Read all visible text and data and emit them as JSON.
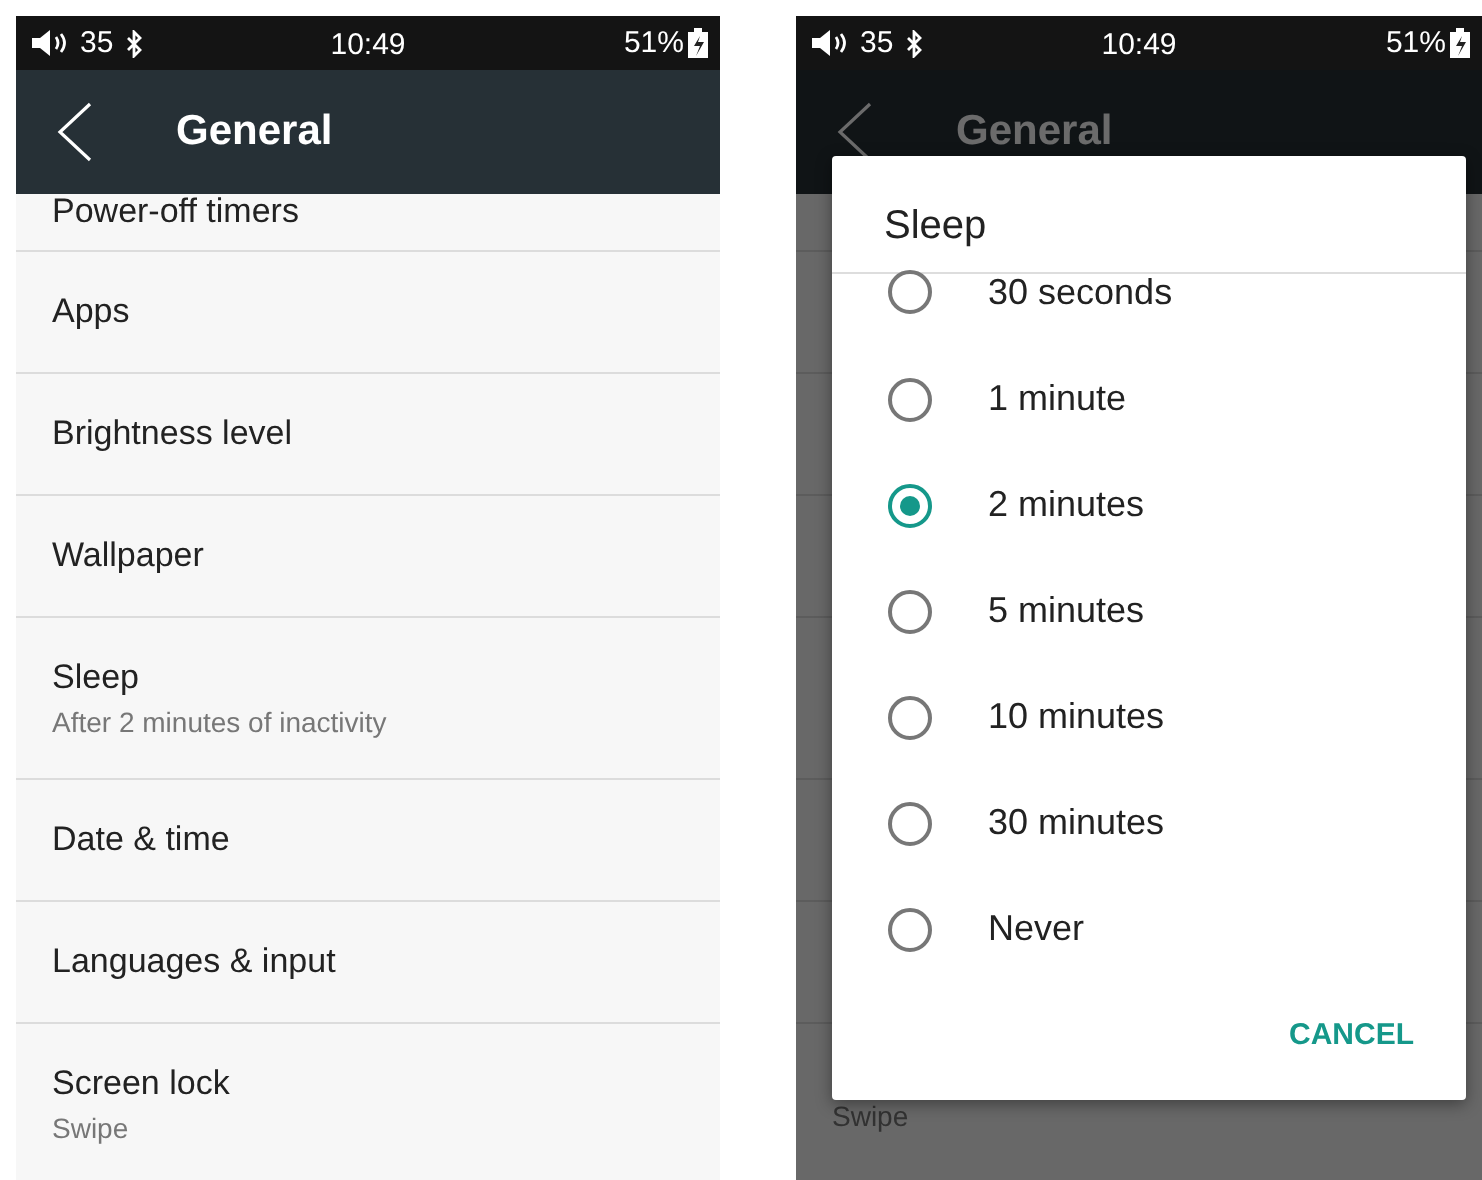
{
  "screens": [
    {
      "status_bar": {
        "volume": "35",
        "time": "10:49",
        "battery": "51%"
      },
      "header": {
        "title": "General"
      },
      "items": [
        {
          "title": "Power-off timers",
          "partial": true
        },
        {
          "title": "Apps"
        },
        {
          "title": "Brightness level"
        },
        {
          "title": "Wallpaper"
        },
        {
          "title": "Sleep",
          "subtitle": "After 2 minutes of inactivity"
        },
        {
          "title": "Date & time"
        },
        {
          "title": "Languages & input"
        },
        {
          "title": "Screen lock",
          "subtitle": "Swipe"
        }
      ]
    },
    {
      "status_bar": {
        "volume": "35",
        "time": "10:49",
        "battery": "51%"
      },
      "header": {
        "title": "General"
      },
      "dimmed": true,
      "background_text": "Swipe",
      "dialog": {
        "title": "Sleep",
        "options": [
          {
            "label": "30 seconds",
            "selected": false
          },
          {
            "label": "1 minute",
            "selected": false
          },
          {
            "label": "2 minutes",
            "selected": true
          },
          {
            "label": "5 minutes",
            "selected": false
          },
          {
            "label": "10 minutes",
            "selected": false
          },
          {
            "label": "30 minutes",
            "selected": false
          },
          {
            "label": "Never",
            "selected": false
          }
        ],
        "button": "CANCEL"
      }
    }
  ]
}
